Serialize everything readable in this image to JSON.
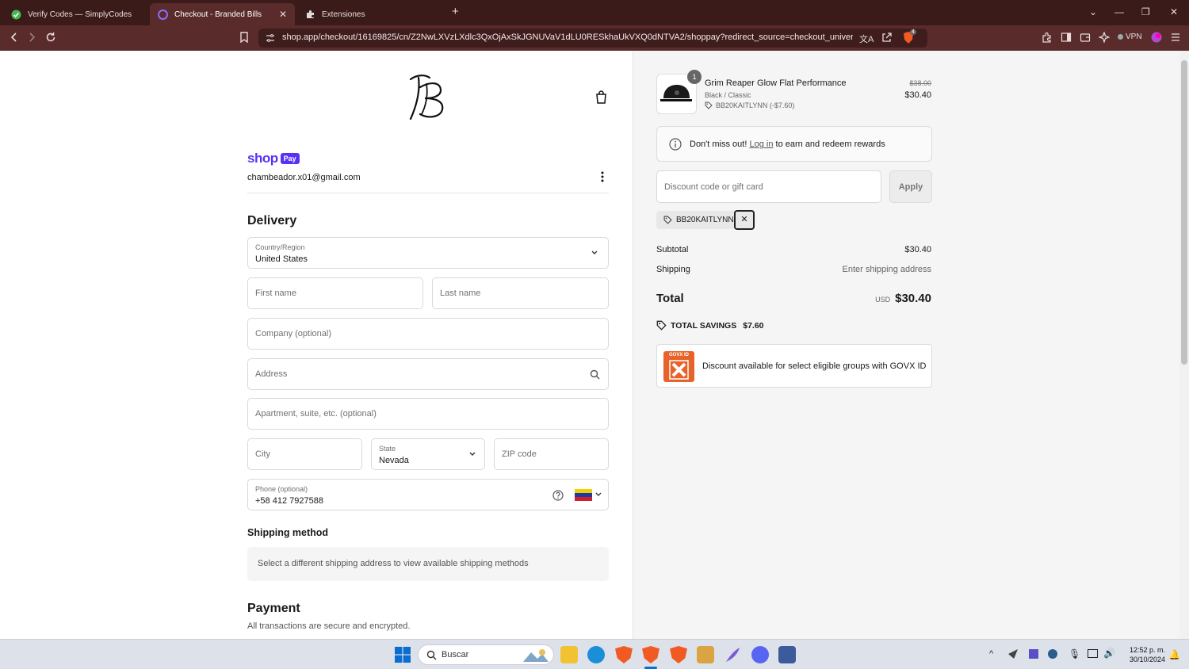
{
  "browser": {
    "tabs": [
      {
        "label": "Verify Codes — SimplyCodes"
      },
      {
        "label": "Checkout - Branded Bills"
      },
      {
        "label": "Extensiones"
      }
    ],
    "url": "shop.app/checkout/16169825/cn/Z2NwLXVzLXdlc3QxOjAxSkJGNUVaV1dLU0RESkhaUkVXQ0dNTVA2/shoppay?redirect_source=checkout_universal...",
    "vpn_label": "VPN",
    "brave_badge": "4"
  },
  "checkout": {
    "shop_brand": "shop",
    "shop_pay_badge": "Pay",
    "email": "chambeador.x01@gmail.com",
    "delivery_title": "Delivery",
    "country_label": "Country/Region",
    "country_value": "United States",
    "first_name_ph": "First name",
    "last_name_ph": "Last name",
    "company_ph": "Company (optional)",
    "address_ph": "Address",
    "apartment_ph": "Apartment, suite, etc. (optional)",
    "city_ph": "City",
    "state_label": "State",
    "state_value": "Nevada",
    "zip_ph": "ZIP code",
    "phone_label": "Phone (optional)",
    "phone_value": "+58 412 7927588",
    "shipping_method_title": "Shipping method",
    "shipping_method_msg": "Select a different shipping address to view available shipping methods",
    "payment_title": "Payment",
    "payment_sub": "All transactions are secure and encrypted."
  },
  "summary": {
    "product": {
      "qty": "1",
      "name": "Grim Reaper Glow Flat Performance",
      "variant": "Black / Classic",
      "discount_line": "BB20KAITLYNN (-$7.60)",
      "original_price": "$38.00",
      "price": "$30.40"
    },
    "rewards": {
      "pre": "Don't miss out!",
      "link": "Log in",
      "post": "to earn and redeem rewards"
    },
    "discount_ph": "Discount code or gift card",
    "apply_label": "Apply",
    "applied_code": "BB20KAITLYNN",
    "subtotal_label": "Subtotal",
    "subtotal_value": "$30.40",
    "shipping_label": "Shipping",
    "shipping_value": "Enter shipping address",
    "total_label": "Total",
    "currency": "USD",
    "total_value": "$30.40",
    "savings_label": "TOTAL SAVINGS",
    "savings_value": "$7.60",
    "govx_logo": "GOVX ID",
    "govx_text": "Discount available for select eligible groups with GOVX ID"
  },
  "taskbar": {
    "search_label": "Buscar",
    "time": "12:52 p. m.",
    "date": "30/10/2024"
  },
  "colors": {
    "tabbar": "#3b1a1a",
    "toolbar": "#5a2b2b",
    "shop_purple": "#5a31f4",
    "govx_orange": "#e8632a"
  }
}
